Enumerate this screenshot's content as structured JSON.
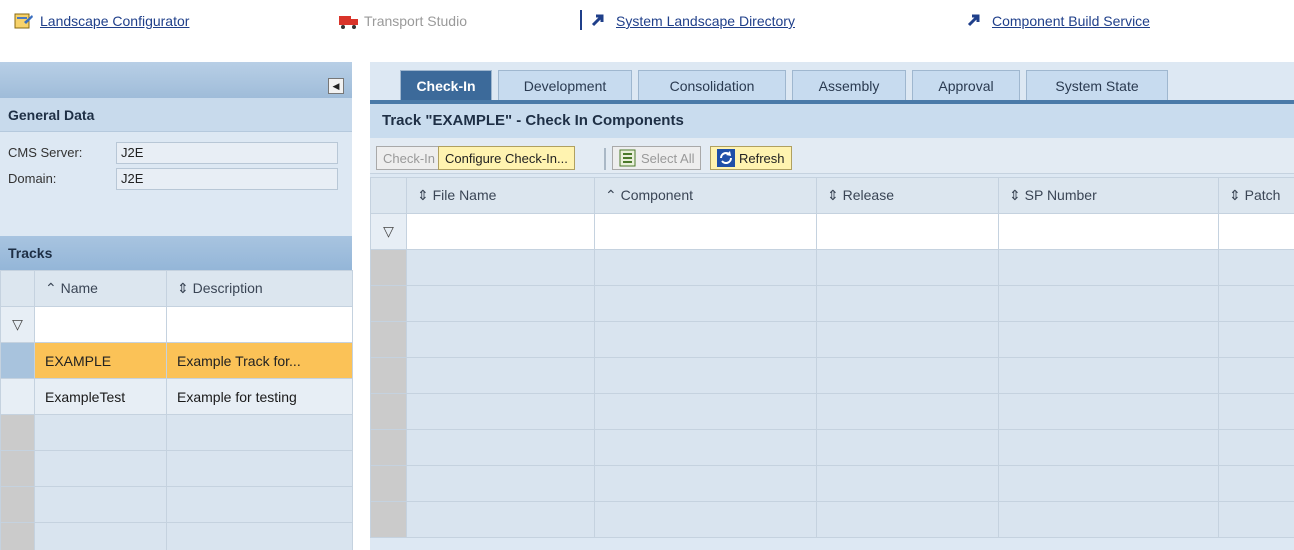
{
  "topnav": {
    "links": [
      {
        "label": "Landscape Configurator",
        "enabled": true,
        "icon": "landscape-configurator-icon"
      },
      {
        "label": "Transport Studio",
        "enabled": false,
        "icon": "truck-icon"
      },
      {
        "label": "System Landscape Directory",
        "enabled": true,
        "icon": "arrow-link-icon"
      },
      {
        "label": "Component Build Service",
        "enabled": true,
        "icon": "arrow-link-icon"
      }
    ]
  },
  "left": {
    "general_title": "General Data",
    "fields": [
      {
        "label": "CMS Server:",
        "value": "J2E"
      },
      {
        "label": "Domain:",
        "value": "J2E"
      }
    ],
    "tracks_title": "Tracks",
    "columns": [
      "Name",
      "Description"
    ],
    "rows": [
      {
        "name": "EXAMPLE",
        "description": "Example Track for...",
        "selected": true
      },
      {
        "name": "ExampleTest",
        "description": "Example for testing",
        "selected": false
      }
    ]
  },
  "right": {
    "tabs": [
      "Check-In",
      "Development",
      "Consolidation",
      "Assembly",
      "Approval",
      "System State"
    ],
    "active_tab": "Check-In",
    "title": "Track \"EXAMPLE\" - Check In Components",
    "toolbar": {
      "checkin": "Check-In",
      "configure": "Configure Check-In...",
      "select_all": "Select All",
      "refresh": "Refresh"
    },
    "columns": [
      "File Name",
      "Component",
      "Release",
      "SP Number",
      "Patch"
    ]
  },
  "colors": {
    "accent": "#3c6a9a",
    "highlight": "#fbc257",
    "panel": "#dde8f3"
  }
}
